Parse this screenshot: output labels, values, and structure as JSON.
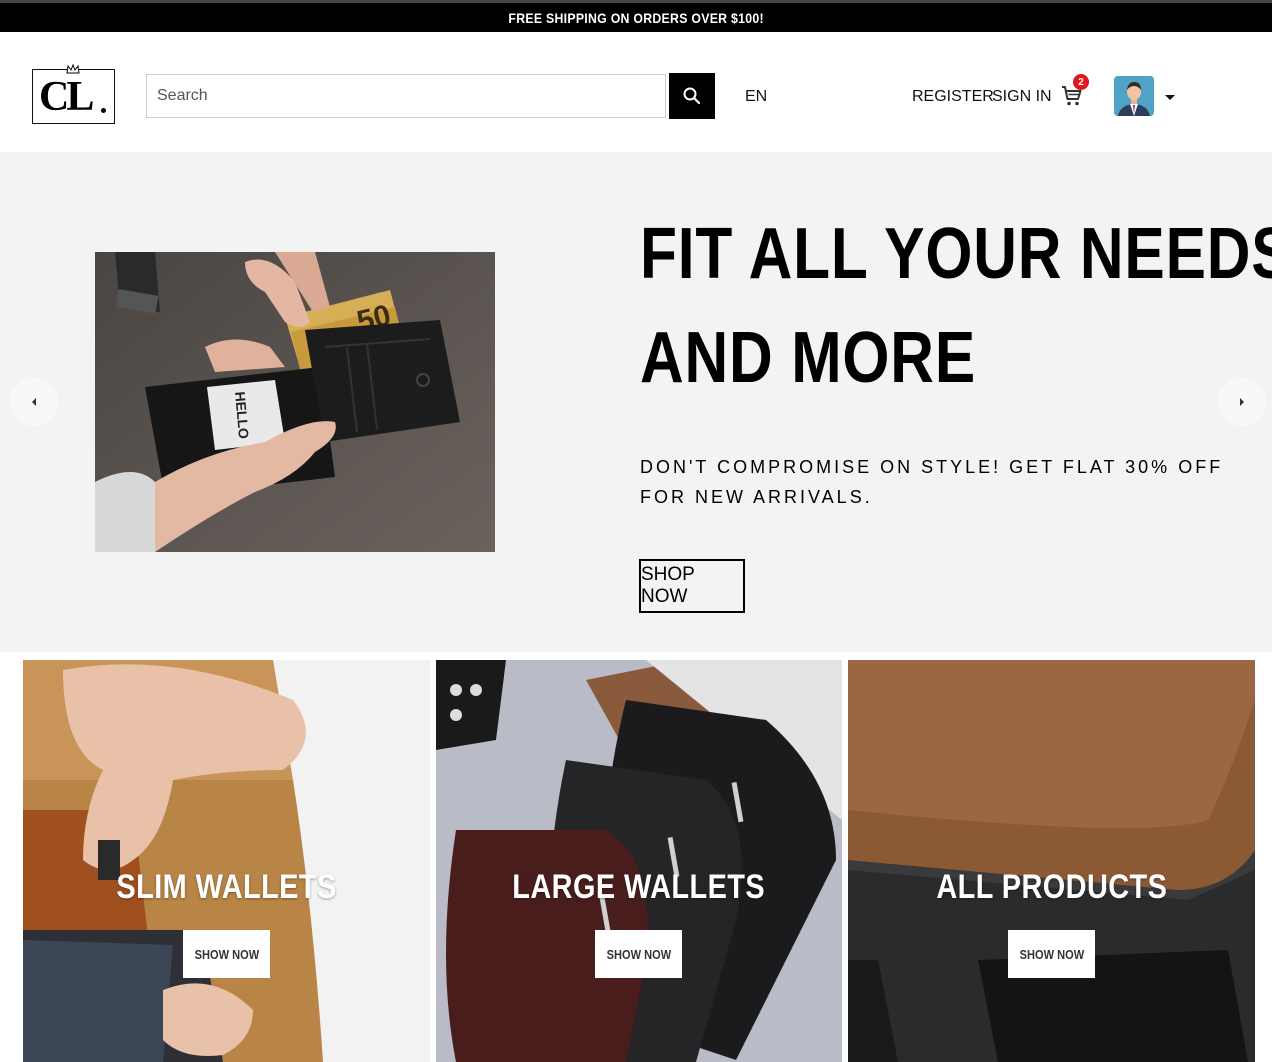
{
  "announcement": "FREE SHIPPING ON ORDERS OVER $100!",
  "header": {
    "logo_text": "CL",
    "search_placeholder": "Search",
    "language": "EN",
    "register_label": "REGISTER",
    "signin_label": "SIGN IN",
    "cart_count": "2"
  },
  "hero": {
    "title_line1": "FIT ALL YOUR NEEDS",
    "title_line2": "AND MORE",
    "subtitle": "DON'T COMPROMISE ON STYLE! GET FLAT 30% OFF FOR NEW ARRIVALS.",
    "button_label": "SHOP NOW",
    "banknote_value": "50",
    "card_text": "HELLO"
  },
  "categories": [
    {
      "title": "SLIM WALLETS",
      "button_label": "SHOW NOW"
    },
    {
      "title": "LARGE WALLETS",
      "button_label": "SHOW NOW"
    },
    {
      "title": "ALL PRODUCTS",
      "button_label": "SHOW NOW"
    }
  ],
  "colors": {
    "topbar_bg": "#000000",
    "hero_bg": "#f3f3f3",
    "cart_badge": "#e0151d"
  },
  "icons": [
    "crown-icon",
    "search-icon",
    "cart-icon",
    "avatar-icon",
    "caret-down-icon",
    "chevron-left-icon",
    "chevron-right-icon"
  ]
}
